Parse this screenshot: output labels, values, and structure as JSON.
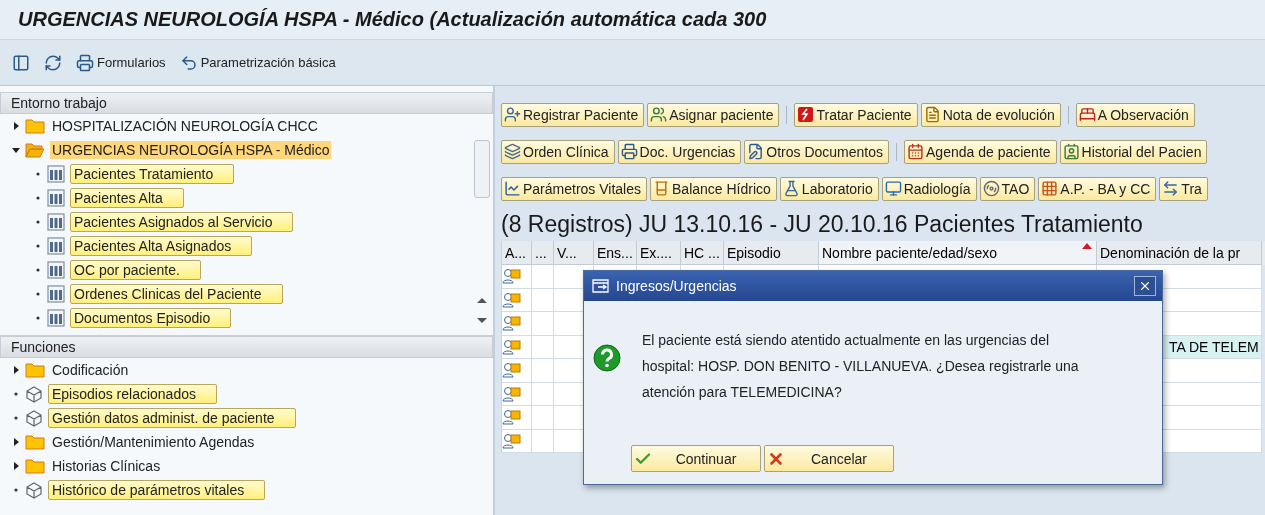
{
  "window": {
    "title": "URGENCIAS NEUROLOGÍA HSPA - Médico (Actualización automática cada 300"
  },
  "toolbar": {
    "buttons": [
      {
        "kind": "layout"
      },
      {
        "kind": "refresh"
      },
      {
        "kind": "print",
        "label": "Formularios"
      },
      {
        "kind": "undo",
        "label": "Parametrización básica"
      }
    ]
  },
  "workspace": {
    "header": "Entorno trabajo",
    "items": [
      {
        "kind": "folder",
        "label": "HOSPITALIZACIÓN NEUROLOGÍA CHCC",
        "expanded": false,
        "selected": false
      },
      {
        "kind": "folder",
        "label": "URGENCIAS NEUROLOGÍA HSPA - Médico",
        "expanded": true,
        "selected": true,
        "children": [
          {
            "kind": "report",
            "label": "Pacientes Tratamiento"
          },
          {
            "kind": "report",
            "label": "Pacientes Alta"
          },
          {
            "kind": "report",
            "label": "Pacientes Asignados al Servicio"
          },
          {
            "kind": "report",
            "label": "Pacientes Alta Asignados"
          },
          {
            "kind": "report",
            "label": "OC por paciente."
          },
          {
            "kind": "report",
            "label": "Ordenes Clinicas del Paciente"
          },
          {
            "kind": "report",
            "label": "Documentos Episodio"
          }
        ]
      }
    ]
  },
  "functions": {
    "header": "Funciones",
    "items": [
      {
        "kind": "folder",
        "label": "Codificación",
        "expanded": false,
        "selected": false
      },
      {
        "kind": "function",
        "label": "Episodios relacionados"
      },
      {
        "kind": "function",
        "label": "Gestión datos administ. de paciente"
      },
      {
        "kind": "folder",
        "label": "Gestión/Mantenimiento Agendas",
        "expanded": false,
        "selected": false
      },
      {
        "kind": "folder",
        "label": "Historias Clínicas",
        "expanded": false,
        "selected": false
      },
      {
        "kind": "function",
        "label": "Histórico de parámetros vitales"
      }
    ]
  },
  "action_rows": [
    [
      {
        "label": "Registrar Paciente",
        "separator_before": false
      },
      {
        "label": "Asignar paciente",
        "separator_before": false
      },
      {
        "label": "Tratar Paciente",
        "separator_before": true
      },
      {
        "label": "Nota de evolución",
        "separator_before": false
      },
      {
        "label": "A Observación",
        "separator_before": true
      }
    ],
    [
      {
        "label": "Orden Clínica",
        "separator_before": false
      },
      {
        "label": "Doc. Urgencias",
        "separator_before": false
      },
      {
        "label": "Otros Documentos",
        "separator_before": false
      },
      {
        "label": "Agenda de paciente",
        "separator_before": true
      },
      {
        "label": "Historial del Pacien",
        "separator_before": false
      }
    ],
    [
      {
        "label": "Parámetros Vitales",
        "separator_before": false
      },
      {
        "label": "Balance Hídrico",
        "separator_before": false
      },
      {
        "label": "Laboratorio",
        "separator_before": false
      },
      {
        "label": "Radiología",
        "separator_before": false
      },
      {
        "label": "TAO",
        "separator_before": false
      },
      {
        "label": "A.P. - BA y CC",
        "separator_before": false
      },
      {
        "label": "Tra",
        "separator_before": false
      }
    ]
  ],
  "list_title": "(8 Registros) JU 13.10.16 - JU 20.10.16 Pacientes Tratamiento",
  "table": {
    "columns": [
      {
        "label": "A...",
        "sorted": false
      },
      {
        "label": "...",
        "sorted": false
      },
      {
        "label": "V...",
        "sorted": false
      },
      {
        "label": "Ens...",
        "sorted": false
      },
      {
        "label": "Ex....",
        "sorted": false
      },
      {
        "label": "HC ...",
        "sorted": false
      },
      {
        "label": "Episodio",
        "sorted": false
      },
      {
        "label": "Nombre paciente/edad/sexo",
        "sorted": true
      },
      {
        "label": "Denominación de la pr",
        "sorted": false
      }
    ],
    "rows": [
      {
        "highlighted": false
      },
      {
        "highlighted": false
      },
      {
        "highlighted": false
      },
      {
        "highlighted": true,
        "text": "TA DE TELEM"
      },
      {
        "highlighted": false
      },
      {
        "highlighted": false
      },
      {
        "highlighted": false
      },
      {
        "highlighted": false
      }
    ]
  },
  "dialog": {
    "title": "Ingresos/Urgencias",
    "message": "El paciente está siendo atentido actualmente en las urgencias del hospital: HOSP. DON BENITO - VILLANUEVA. ¿Desea registrarle una atención para TELEMEDICINA?",
    "buttons": [
      {
        "kind": "confirm",
        "label": "Continuar"
      },
      {
        "kind": "cancel",
        "label": "Cancelar"
      }
    ]
  }
}
